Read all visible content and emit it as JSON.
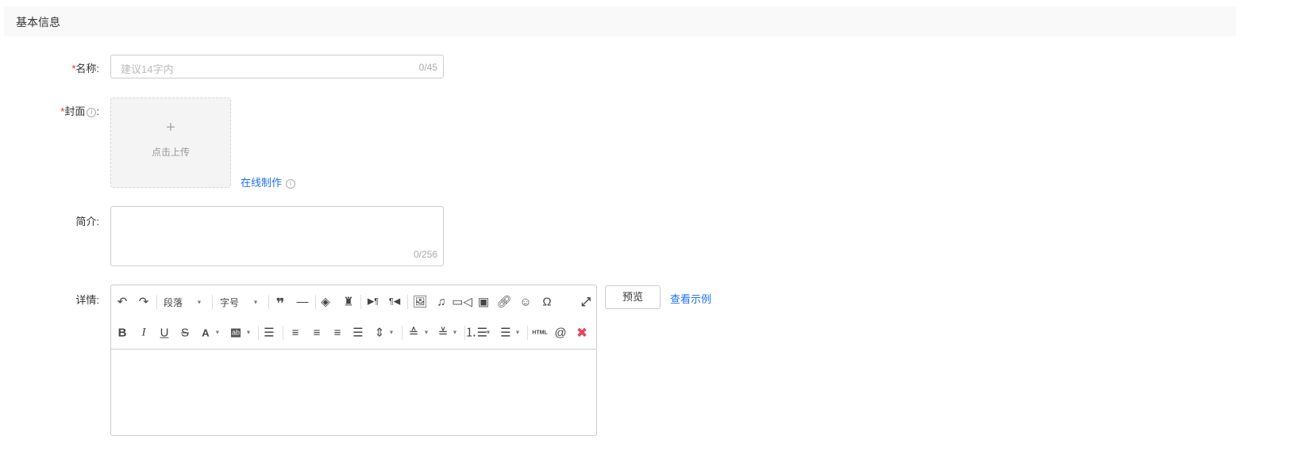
{
  "section_title": "基本信息",
  "fields": {
    "name": {
      "required": "*",
      "label": "名称:",
      "placeholder": "建议14字内",
      "counter": "0/45"
    },
    "cover": {
      "required": "*",
      "label": "封面",
      "colon": ":",
      "upload_plus": "+",
      "upload_text": "点击上传",
      "online_link": "在线制作"
    },
    "intro": {
      "label": "简介:",
      "counter": "0/256"
    },
    "detail": {
      "label": "详情:",
      "preview": "预览",
      "example_link": "查看示例"
    }
  },
  "toolbar": {
    "paragraph": "段落",
    "font_size": "字号",
    "html": "HTML",
    "icons": [
      "undo-icon",
      "redo-icon",
      "quote-icon",
      "horizontal-rule-icon",
      "eraser-icon",
      "format-brush-icon",
      "ltr-icon",
      "rtl-icon",
      "image-icon",
      "music-icon",
      "video-icon",
      "media-icon",
      "link-icon",
      "emoji-icon",
      "omega-icon",
      "fullscreen-icon",
      "bold-icon",
      "italic-icon",
      "underline-icon",
      "strikethrough-icon",
      "font-color-icon",
      "background-color-icon",
      "indent-icon",
      "align-left-icon",
      "align-center-icon",
      "align-right-icon",
      "align-justify-icon",
      "line-height-icon",
      "paragraph-spacing-top-icon",
      "paragraph-spacing-bottom-icon",
      "ordered-list-icon",
      "unordered-list-icon",
      "html-icon",
      "at-icon",
      "plugin-icon"
    ]
  },
  "colors": {
    "link": "#1f6fff",
    "required": "#f5222d",
    "header_bg": "#f9f9f9"
  }
}
